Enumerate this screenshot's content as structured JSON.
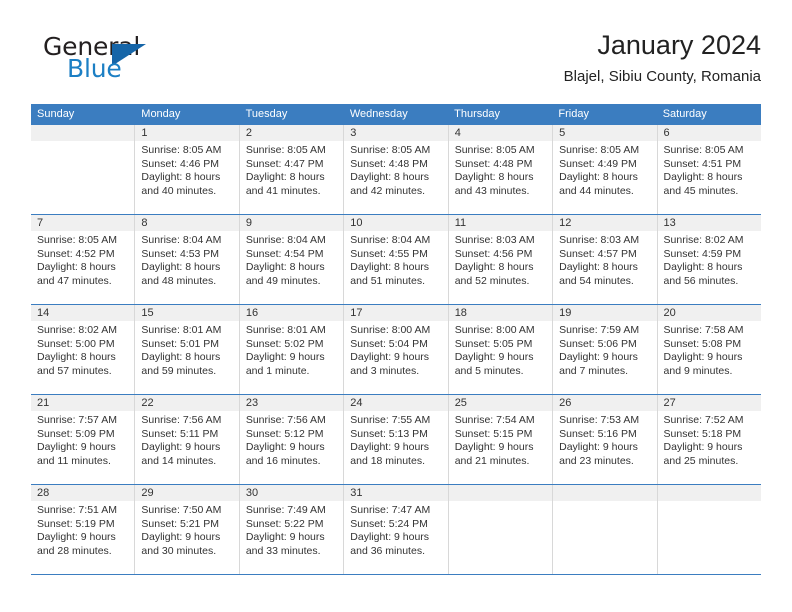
{
  "brand": {
    "name_primary": "General",
    "name_secondary": "Blue",
    "flag_icon": "triangle-flag-icon"
  },
  "header": {
    "title": "January 2024",
    "subtitle": "Blajel, Sibiu County, Romania"
  },
  "colors": {
    "header_blue": "#3b7dc0",
    "brand_blue": "#1c7fc4",
    "day_number_bg": "#f0f0f0",
    "cell_border": "#d8d8d8",
    "text": "#333333"
  },
  "weekdays": [
    "Sunday",
    "Monday",
    "Tuesday",
    "Wednesday",
    "Thursday",
    "Friday",
    "Saturday"
  ],
  "labels": {
    "sunrise": "Sunrise:",
    "sunset": "Sunset:",
    "daylight": "Daylight:"
  },
  "weeks": [
    [
      {
        "day": "",
        "sunrise": "",
        "sunset": "",
        "daylight_1": "",
        "daylight_2": ""
      },
      {
        "day": "1",
        "sunrise": "Sunrise: 8:05 AM",
        "sunset": "Sunset: 4:46 PM",
        "daylight_1": "Daylight: 8 hours",
        "daylight_2": "and 40 minutes."
      },
      {
        "day": "2",
        "sunrise": "Sunrise: 8:05 AM",
        "sunset": "Sunset: 4:47 PM",
        "daylight_1": "Daylight: 8 hours",
        "daylight_2": "and 41 minutes."
      },
      {
        "day": "3",
        "sunrise": "Sunrise: 8:05 AM",
        "sunset": "Sunset: 4:48 PM",
        "daylight_1": "Daylight: 8 hours",
        "daylight_2": "and 42 minutes."
      },
      {
        "day": "4",
        "sunrise": "Sunrise: 8:05 AM",
        "sunset": "Sunset: 4:48 PM",
        "daylight_1": "Daylight: 8 hours",
        "daylight_2": "and 43 minutes."
      },
      {
        "day": "5",
        "sunrise": "Sunrise: 8:05 AM",
        "sunset": "Sunset: 4:49 PM",
        "daylight_1": "Daylight: 8 hours",
        "daylight_2": "and 44 minutes."
      },
      {
        "day": "6",
        "sunrise": "Sunrise: 8:05 AM",
        "sunset": "Sunset: 4:51 PM",
        "daylight_1": "Daylight: 8 hours",
        "daylight_2": "and 45 minutes."
      }
    ],
    [
      {
        "day": "7",
        "sunrise": "Sunrise: 8:05 AM",
        "sunset": "Sunset: 4:52 PM",
        "daylight_1": "Daylight: 8 hours",
        "daylight_2": "and 47 minutes."
      },
      {
        "day": "8",
        "sunrise": "Sunrise: 8:04 AM",
        "sunset": "Sunset: 4:53 PM",
        "daylight_1": "Daylight: 8 hours",
        "daylight_2": "and 48 minutes."
      },
      {
        "day": "9",
        "sunrise": "Sunrise: 8:04 AM",
        "sunset": "Sunset: 4:54 PM",
        "daylight_1": "Daylight: 8 hours",
        "daylight_2": "and 49 minutes."
      },
      {
        "day": "10",
        "sunrise": "Sunrise: 8:04 AM",
        "sunset": "Sunset: 4:55 PM",
        "daylight_1": "Daylight: 8 hours",
        "daylight_2": "and 51 minutes."
      },
      {
        "day": "11",
        "sunrise": "Sunrise: 8:03 AM",
        "sunset": "Sunset: 4:56 PM",
        "daylight_1": "Daylight: 8 hours",
        "daylight_2": "and 52 minutes."
      },
      {
        "day": "12",
        "sunrise": "Sunrise: 8:03 AM",
        "sunset": "Sunset: 4:57 PM",
        "daylight_1": "Daylight: 8 hours",
        "daylight_2": "and 54 minutes."
      },
      {
        "day": "13",
        "sunrise": "Sunrise: 8:02 AM",
        "sunset": "Sunset: 4:59 PM",
        "daylight_1": "Daylight: 8 hours",
        "daylight_2": "and 56 minutes."
      }
    ],
    [
      {
        "day": "14",
        "sunrise": "Sunrise: 8:02 AM",
        "sunset": "Sunset: 5:00 PM",
        "daylight_1": "Daylight: 8 hours",
        "daylight_2": "and 57 minutes."
      },
      {
        "day": "15",
        "sunrise": "Sunrise: 8:01 AM",
        "sunset": "Sunset: 5:01 PM",
        "daylight_1": "Daylight: 8 hours",
        "daylight_2": "and 59 minutes."
      },
      {
        "day": "16",
        "sunrise": "Sunrise: 8:01 AM",
        "sunset": "Sunset: 5:02 PM",
        "daylight_1": "Daylight: 9 hours",
        "daylight_2": "and 1 minute."
      },
      {
        "day": "17",
        "sunrise": "Sunrise: 8:00 AM",
        "sunset": "Sunset: 5:04 PM",
        "daylight_1": "Daylight: 9 hours",
        "daylight_2": "and 3 minutes."
      },
      {
        "day": "18",
        "sunrise": "Sunrise: 8:00 AM",
        "sunset": "Sunset: 5:05 PM",
        "daylight_1": "Daylight: 9 hours",
        "daylight_2": "and 5 minutes."
      },
      {
        "day": "19",
        "sunrise": "Sunrise: 7:59 AM",
        "sunset": "Sunset: 5:06 PM",
        "daylight_1": "Daylight: 9 hours",
        "daylight_2": "and 7 minutes."
      },
      {
        "day": "20",
        "sunrise": "Sunrise: 7:58 AM",
        "sunset": "Sunset: 5:08 PM",
        "daylight_1": "Daylight: 9 hours",
        "daylight_2": "and 9 minutes."
      }
    ],
    [
      {
        "day": "21",
        "sunrise": "Sunrise: 7:57 AM",
        "sunset": "Sunset: 5:09 PM",
        "daylight_1": "Daylight: 9 hours",
        "daylight_2": "and 11 minutes."
      },
      {
        "day": "22",
        "sunrise": "Sunrise: 7:56 AM",
        "sunset": "Sunset: 5:11 PM",
        "daylight_1": "Daylight: 9 hours",
        "daylight_2": "and 14 minutes."
      },
      {
        "day": "23",
        "sunrise": "Sunrise: 7:56 AM",
        "sunset": "Sunset: 5:12 PM",
        "daylight_1": "Daylight: 9 hours",
        "daylight_2": "and 16 minutes."
      },
      {
        "day": "24",
        "sunrise": "Sunrise: 7:55 AM",
        "sunset": "Sunset: 5:13 PM",
        "daylight_1": "Daylight: 9 hours",
        "daylight_2": "and 18 minutes."
      },
      {
        "day": "25",
        "sunrise": "Sunrise: 7:54 AM",
        "sunset": "Sunset: 5:15 PM",
        "daylight_1": "Daylight: 9 hours",
        "daylight_2": "and 21 minutes."
      },
      {
        "day": "26",
        "sunrise": "Sunrise: 7:53 AM",
        "sunset": "Sunset: 5:16 PM",
        "daylight_1": "Daylight: 9 hours",
        "daylight_2": "and 23 minutes."
      },
      {
        "day": "27",
        "sunrise": "Sunrise: 7:52 AM",
        "sunset": "Sunset: 5:18 PM",
        "daylight_1": "Daylight: 9 hours",
        "daylight_2": "and 25 minutes."
      }
    ],
    [
      {
        "day": "28",
        "sunrise": "Sunrise: 7:51 AM",
        "sunset": "Sunset: 5:19 PM",
        "daylight_1": "Daylight: 9 hours",
        "daylight_2": "and 28 minutes."
      },
      {
        "day": "29",
        "sunrise": "Sunrise: 7:50 AM",
        "sunset": "Sunset: 5:21 PM",
        "daylight_1": "Daylight: 9 hours",
        "daylight_2": "and 30 minutes."
      },
      {
        "day": "30",
        "sunrise": "Sunrise: 7:49 AM",
        "sunset": "Sunset: 5:22 PM",
        "daylight_1": "Daylight: 9 hours",
        "daylight_2": "and 33 minutes."
      },
      {
        "day": "31",
        "sunrise": "Sunrise: 7:47 AM",
        "sunset": "Sunset: 5:24 PM",
        "daylight_1": "Daylight: 9 hours",
        "daylight_2": "and 36 minutes."
      },
      {
        "day": "",
        "sunrise": "",
        "sunset": "",
        "daylight_1": "",
        "daylight_2": ""
      },
      {
        "day": "",
        "sunrise": "",
        "sunset": "",
        "daylight_1": "",
        "daylight_2": ""
      },
      {
        "day": "",
        "sunrise": "",
        "sunset": "",
        "daylight_1": "",
        "daylight_2": ""
      }
    ]
  ]
}
